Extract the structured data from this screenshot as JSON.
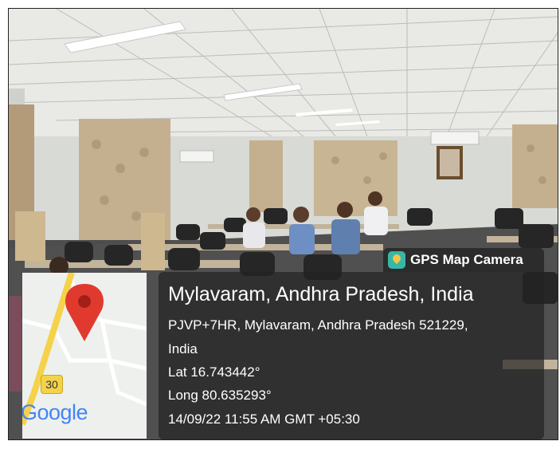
{
  "badge": {
    "icon": "map-pin-camera-icon",
    "label": "GPS Map Camera"
  },
  "location": {
    "title": "Mylavaram, Andhra Pradesh, India",
    "address_line1": "PJVP+7HR, Mylavaram, Andhra Pradesh 521229,",
    "address_line2": "India",
    "latitude": "Lat 16.743442°",
    "longitude": "Long 80.635293°",
    "timestamp": "14/09/22 11:55 AM GMT +05:30"
  },
  "map": {
    "route_number": "30",
    "provider_logo": "Google",
    "pin_icon": "red-location-pin-icon",
    "colors": {
      "pin": "#e03a2f",
      "road_yellow": "#f4d24a",
      "map_bg": "#eef0ee"
    }
  },
  "scene": {
    "colors": {
      "ceiling": "#e8e8e4",
      "wall": "#d6d8d4",
      "curtain": "#c7b59a",
      "floor": "#4a4a4a",
      "chair": "#2a2a2a",
      "desk": "#b8a890"
    }
  }
}
